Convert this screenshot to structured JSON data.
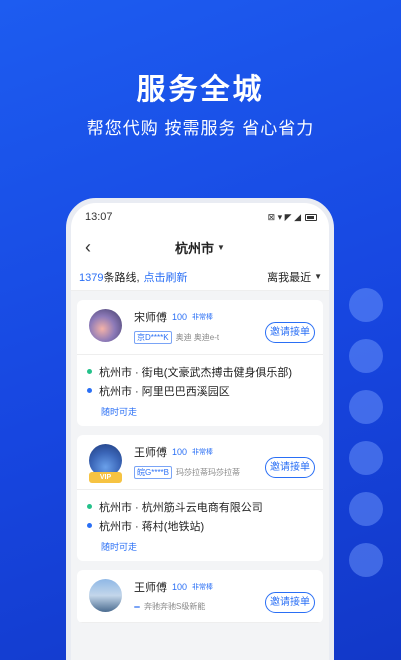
{
  "promo": {
    "title": "服务全城",
    "subtitle": "帮您代购 按需服务 省心省力"
  },
  "statusbar": {
    "time": "13:07",
    "icons": "⊠ ▾ ◤ ◢"
  },
  "navbar": {
    "back_icon": "‹",
    "city": "杭州市",
    "caret": "▼"
  },
  "toolbar": {
    "route_count": "1379",
    "route_count_suffix": "条路线,",
    "refresh_label": "点击刷新",
    "sort_label": "离我最近"
  },
  "cards": [
    {
      "name": "宋师傅",
      "score": "100",
      "tag": "非常棒",
      "plate": "京D****K",
      "car": "奥迪 奥迪e-t",
      "vip": "",
      "invite_label": "邀请接单",
      "from": "杭州市 · 街电(文豪武杰搏击健身俱乐部)",
      "to": "杭州市 · 阿里巴巴西溪园区",
      "availability": "随时可走"
    },
    {
      "name": "王师傅",
      "score": "100",
      "tag": "非常棒",
      "plate": "皖G****B",
      "car": "玛莎拉蒂玛莎拉蒂",
      "vip": "VIP",
      "invite_label": "邀请接单",
      "from": "杭州市 · 杭州筋斗云电商有限公司",
      "to": "杭州市 · 蒋村(地铁站)",
      "availability": "随时可走"
    },
    {
      "name": "王师傅",
      "score": "100",
      "tag": "非常棒",
      "plate": "",
      "car": "奔驰奔驰S级新能",
      "vip": "",
      "invite_label": "邀请接单",
      "from": "",
      "to": "",
      "availability": ""
    }
  ],
  "colors": {
    "accent": "#2a6ff5",
    "start_dot": "#24c18a",
    "background": "#1746e0"
  }
}
